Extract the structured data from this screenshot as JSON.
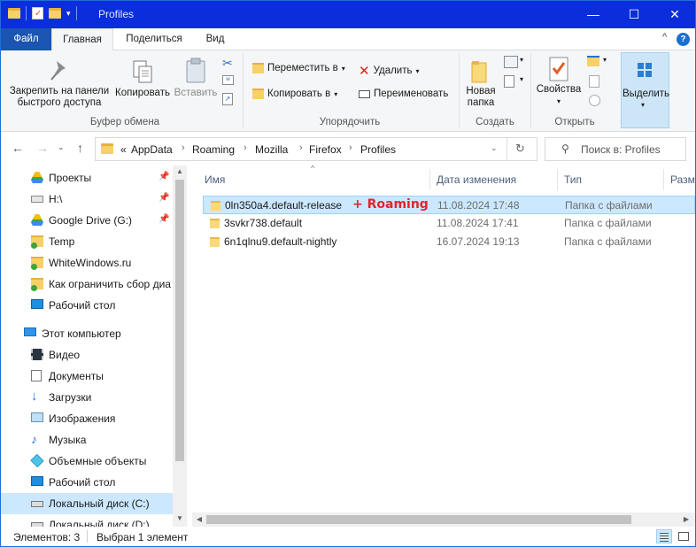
{
  "window": {
    "title": "Profiles",
    "controls": {
      "minimize": "—",
      "maximize": "☐",
      "close": "✕"
    }
  },
  "ribbon_tabs": [
    "Файл",
    "Главная",
    "Поделиться",
    "Вид"
  ],
  "ribbon": {
    "clipboard": {
      "pin_label": "Закрепить на панели быстрого доступа",
      "copy_label": "Копировать",
      "paste_label": "Вставить",
      "group_label": "Буфер обмена"
    },
    "organize": {
      "move_to": "Переместить в",
      "copy_to": "Копировать в",
      "delete": "Удалить",
      "rename": "Переименовать",
      "group_label": "Упорядочить"
    },
    "new": {
      "new_folder_label": "Новая папка",
      "group_label": "Создать"
    },
    "open": {
      "properties_label": "Свойства",
      "group_label": "Открыть"
    },
    "select": {
      "select_label": "Выделить"
    }
  },
  "address": {
    "prefix": "«",
    "breadcrumbs": [
      "AppData",
      "Roaming",
      "Mozilla",
      "Firefox",
      "Profiles"
    ]
  },
  "search": {
    "placeholder": "Поиск в: Profiles"
  },
  "nav_pane": {
    "quick_access": [
      {
        "label": "Проекты",
        "icon": "drive-project-icon",
        "pinned": true
      },
      {
        "label": "H:\\",
        "icon": "drive-icon",
        "pinned": true
      },
      {
        "label": "Google Drive (G:)",
        "icon": "google-drive-icon",
        "pinned": true
      },
      {
        "label": "Temp",
        "icon": "folder-icon",
        "pinned": false
      },
      {
        "label": "WhiteWindows.ru",
        "icon": "folder-icon",
        "pinned": false
      },
      {
        "label": "Как ограничить сбор диа",
        "icon": "folder-icon",
        "pinned": false
      },
      {
        "label": "Рабочий стол",
        "icon": "desktop-icon",
        "pinned": false
      }
    ],
    "this_pc": {
      "label": "Этот компьютер",
      "items": [
        {
          "label": "Видео",
          "icon": "video-icon"
        },
        {
          "label": "Документы",
          "icon": "documents-icon"
        },
        {
          "label": "Загрузки",
          "icon": "downloads-icon"
        },
        {
          "label": "Изображения",
          "icon": "pictures-icon"
        },
        {
          "label": "Музыка",
          "icon": "music-icon"
        },
        {
          "label": "Объемные объекты",
          "icon": "3d-objects-icon"
        },
        {
          "label": "Рабочий стол",
          "icon": "desktop-icon"
        },
        {
          "label": "Локальный диск (C:)",
          "icon": "local-disk-icon",
          "selected": true
        },
        {
          "label": "Локальный диск (D:)",
          "icon": "local-disk-icon"
        }
      ]
    }
  },
  "file_list": {
    "columns": [
      "Имя",
      "Дата изменения",
      "Тип",
      "Разме"
    ],
    "rows": [
      {
        "name": "0ln350a4.default-release",
        "date": "11.08.2024 17:48",
        "type": "Папка с файлами",
        "selected": true,
        "annotation": "+ Roaming"
      },
      {
        "name": "3svkr738.default",
        "date": "11.08.2024 17:41",
        "type": "Папка с файлами",
        "selected": false
      },
      {
        "name": "6n1qlnu9.default-nightly",
        "date": "16.07.2024 19:13",
        "type": "Папка с файлами",
        "selected": false
      }
    ]
  },
  "status": {
    "items_count": "Элементов: 3",
    "selected_count": "Выбран 1 элемент"
  },
  "colors": {
    "titlebar": "#0b2edc",
    "file_tab": "#1a55b2",
    "selection": "#cce8ff",
    "annotation": "#e3242b"
  }
}
